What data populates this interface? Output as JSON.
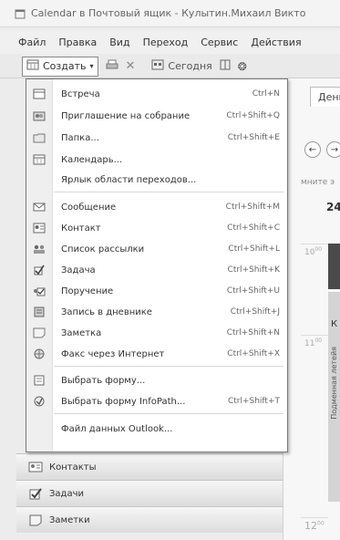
{
  "window": {
    "title": "Calendar в Почтовый ящик - Кулытин.Михаил Викто"
  },
  "menubar": {
    "items": [
      "Файл",
      "Правка",
      "Вид",
      "Переход",
      "Сервис",
      "Действия"
    ]
  },
  "toolbar": {
    "create_label": "Создать",
    "today_label": "Сегодня"
  },
  "calendar": {
    "tab_day": "День",
    "hint": "мните э",
    "day_number": "24",
    "sidebar_letter": "К",
    "vertical_text": "Подменная летейя",
    "times": [
      "10",
      "11",
      "12"
    ],
    "time_minutes": "00"
  },
  "menu": {
    "items": [
      {
        "label": "Встреча",
        "shortcut": "Ctrl+N",
        "icon": "appointment-icon"
      },
      {
        "label": "Приглашение на собрание",
        "shortcut": "Ctrl+Shift+Q",
        "icon": "meeting-request-icon"
      },
      {
        "label": "Папка...",
        "shortcut": "Ctrl+Shift+E",
        "icon": "folder-icon"
      },
      {
        "label": "Календарь...",
        "shortcut": "",
        "icon": "calendar-icon"
      },
      {
        "label": "Ярлык области переходов...",
        "shortcut": "",
        "icon": ""
      },
      {
        "label": "Сообщение",
        "shortcut": "Ctrl+Shift+M",
        "icon": "message-icon"
      },
      {
        "label": "Контакт",
        "shortcut": "Ctrl+Shift+C",
        "icon": "contact-icon"
      },
      {
        "label": "Список рассылки",
        "shortcut": "Ctrl+Shift+L",
        "icon": "distribution-list-icon"
      },
      {
        "label": "Задача",
        "shortcut": "Ctrl+Shift+K",
        "icon": "task-icon"
      },
      {
        "label": "Поручение",
        "shortcut": "Ctrl+Shift+U",
        "icon": "task-request-icon"
      },
      {
        "label": "Запись в дневнике",
        "shortcut": "Ctrl+Shift+J",
        "icon": "journal-entry-icon"
      },
      {
        "label": "Заметка",
        "shortcut": "Ctrl+Shift+N",
        "icon": "note-icon"
      },
      {
        "label": "Факс через Интернет",
        "shortcut": "Ctrl+Shift+X",
        "icon": "internet-fax-icon"
      },
      {
        "label": "Выбрать форму...",
        "shortcut": "",
        "icon": "choose-form-icon"
      },
      {
        "label": "Выбрать форму InfoPath...",
        "shortcut": "Ctrl+Shift+T",
        "icon": "infopath-form-icon"
      },
      {
        "label": "Файл данных Outlook...",
        "shortcut": "",
        "icon": ""
      }
    ]
  },
  "navpane": {
    "items": [
      {
        "label": "Контакты",
        "icon": "contacts-icon"
      },
      {
        "label": "Задачи",
        "icon": "tasks-icon"
      },
      {
        "label": "Заметки",
        "icon": "notes-icon"
      }
    ]
  }
}
